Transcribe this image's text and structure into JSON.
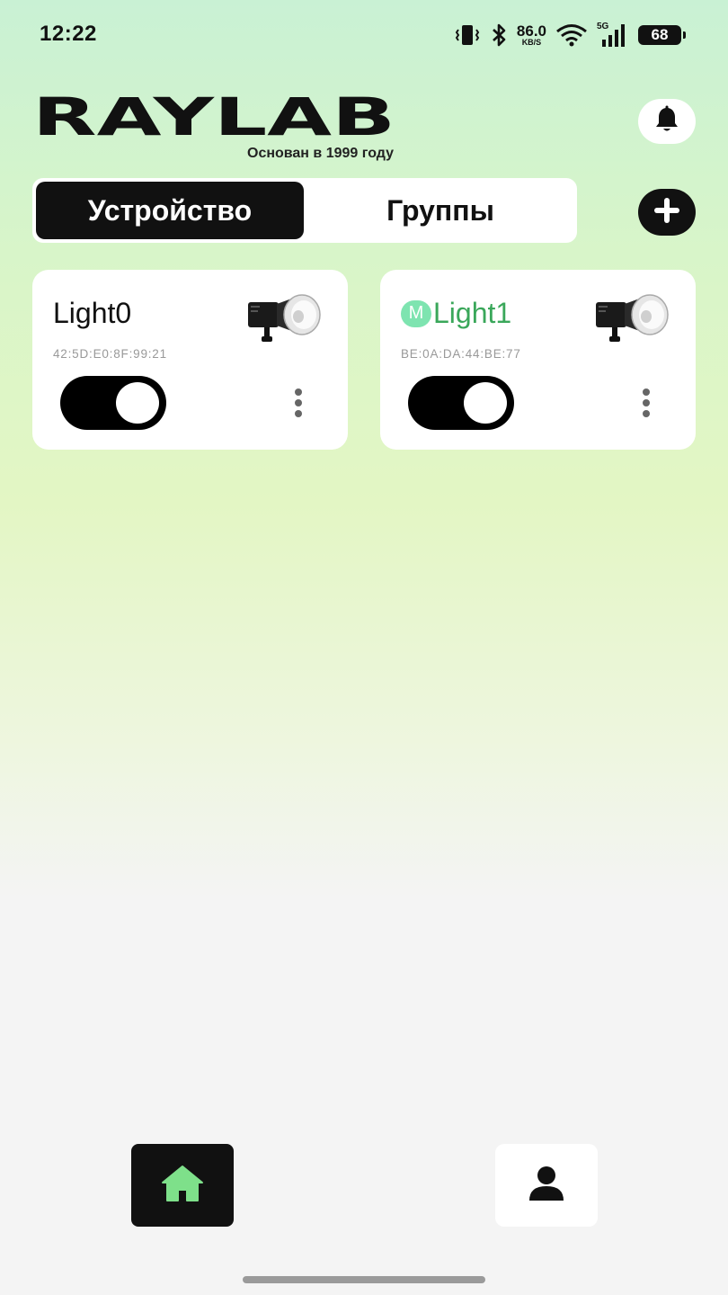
{
  "status_bar": {
    "time": "12:22",
    "network_speed": "86.0",
    "network_speed_unit": "KB/S",
    "network_type": "5G",
    "battery": "68",
    "icons": [
      "vibrate-icon",
      "bluetooth-icon",
      "wifi-icon",
      "signal-icon",
      "battery-icon"
    ]
  },
  "header": {
    "logo_text": "RAYLAB",
    "tagline": "Основан в 1999 году",
    "notification_icon": "bell-icon"
  },
  "tabs": {
    "active_label": "Устройство",
    "inactive_label": "Группы",
    "add_icon": "plus-icon"
  },
  "devices": [
    {
      "name": "Light0",
      "badge": "",
      "mac": "42:5D:E0:8F:99:21",
      "on": true,
      "image_icon": "studio-light-icon"
    },
    {
      "name": "Light1",
      "badge": "M",
      "mac": "BE:0A:DA:44:BE:77",
      "on": true,
      "image_icon": "studio-light-icon"
    }
  ],
  "bottom_nav": {
    "items": [
      {
        "icon": "home-icon",
        "active": true
      },
      {
        "icon": "profile-icon",
        "active": false
      }
    ]
  },
  "colors": {
    "accent_green": "#7ee08a",
    "active_dark": "#111111",
    "device_name_green": "#3aa75a"
  }
}
